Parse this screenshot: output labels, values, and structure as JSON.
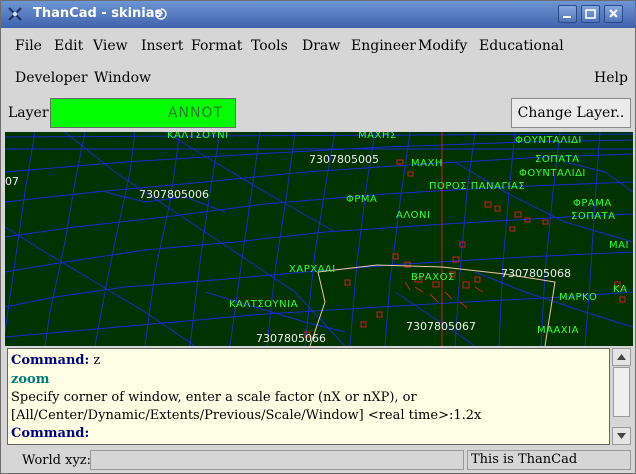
{
  "window": {
    "title": "ThanCad - skinias"
  },
  "menubar": {
    "row1": [
      "File",
      "Edit",
      "View",
      "Insert",
      "Format",
      "Tools",
      "Draw",
      "Engineer",
      "Modify",
      "Educational"
    ],
    "row2": [
      "Developer",
      "Window"
    ],
    "help": "Help"
  },
  "layerbar": {
    "label": "Layer:",
    "value": "ANNOT",
    "value_color": "#00ff00",
    "change_button": "Change Layer.."
  },
  "canvas": {
    "background": "#003300",
    "line_color": "#1a2acc",
    "axis_color": "#cc2222",
    "labels": {
      "greek_top1": "ΚΑΛΤΣΟΥΝΙ",
      "greek_top2": "ΜΑΧΗΣ",
      "greek_top3": "ΦΟΥΝΤΑΛΙΔΙ",
      "code1": "7307805005",
      "greek_maxi": "ΜΑΧΗ",
      "greek_sopata1": "ΣΟΠΑΤΑ",
      "greek_fountalidi2": "ΦΟΥΝΤΑΛΙΔΙ",
      "code_left": "07",
      "code2": "7307805006",
      "greek_frma": "ΦΡΜΑ",
      "greek_poros": "ΠΟΡΟΣ ΠΑΝΑΓΙΑΣ",
      "greek_frama2": "ΦΡΑΜΑ",
      "greek_sopata2": "ΣΟΠΑΤΑ",
      "greek_alon": "ΑΛΟΝΙ",
      "greek_mai": "ΜΑΙ",
      "greek_xarxali": "ΧΑΡΧΑΛΙ",
      "greek_vraxos": "ΒΡΑΧΟΣ",
      "code3": "7307805068",
      "greek_kaltsounia": "ΚΑΛΤΣΟΥΝΙΑ",
      "greek_marko": "ΜΑΡΚΟ",
      "greek_ka": "ΚΑ",
      "code4": "7307805067",
      "greek_maaxia": "ΜΑΑΧΙΑ",
      "code5": "7307805066"
    }
  },
  "console": {
    "line1_label": "Command:",
    "line1_value": " z",
    "line2": "zoom",
    "line3": "Specify corner of window, enter a scale factor (nX or nXP), or",
    "line4": "[All/Center/Dynamic/Extents/Previous/Scale/Window] <real time>:1.2x",
    "line5_label": "Command:"
  },
  "statusbar": {
    "coords_label": "World xyz:",
    "coords_value": "",
    "message": "This is ThanCad"
  }
}
